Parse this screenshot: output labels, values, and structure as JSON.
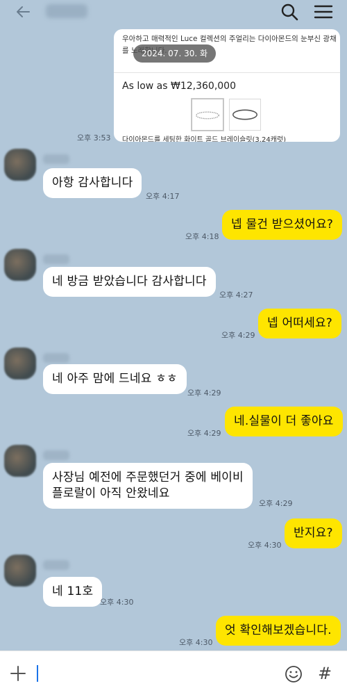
{
  "colors": {
    "background": "#b2c7d9",
    "incoming_bubble": "#ffffff",
    "outgoing_bubble": "#fee500",
    "date_pill": "#505050"
  },
  "header": {
    "back_icon": "arrow-left-icon",
    "search_icon": "search-icon",
    "menu_icon": "hamburger-menu-icon"
  },
  "product_card": {
    "description": "우아하고 매력적인 Luce 컬렉션의 주얼리는 다이아몬드의 눈부신 광채를 노래합니다.",
    "price": "As low as ₩12,360,000",
    "caption": "다이아몬드를 세팅한 화이트 골드 브레이슬릿(3.24캐럿)",
    "time": "오후 3:53"
  },
  "date_divider": "2024. 07. 30. 화",
  "messages": [
    {
      "text": "아항 감사합니다",
      "time": "오후 4:17"
    },
    {
      "text": "넵 물건 받으셨어요?",
      "time": "오후 4:18"
    },
    {
      "text": "네 방금 받았습니다 감사합니다",
      "time": "오후 4:27"
    },
    {
      "text": "넵 어떠세요?",
      "time": "오후 4:29"
    },
    {
      "text": "네 아주 맘에 드네요 ㅎㅎ",
      "time": "오후 4:29"
    },
    {
      "text": "네.실물이 더 좋아요",
      "time": "오후 4:29"
    },
    {
      "text": "사장님 예전에 주문했던거 중에 베이비\n플로랄이 아직 안왔네요",
      "time": "오후 4:29"
    },
    {
      "text": "반지요?",
      "time": "오후 4:30"
    },
    {
      "text": "네 11호",
      "time": "오후 4:30"
    },
    {
      "text": "엇 확인해보겠습니다.",
      "time": "오후 4:30"
    }
  ],
  "input": {
    "placeholder": "",
    "plus_icon": "plus-icon",
    "emoji_icon": "emoji-icon",
    "hash_icon": "hashtag-icon",
    "hash_glyph": "#"
  }
}
